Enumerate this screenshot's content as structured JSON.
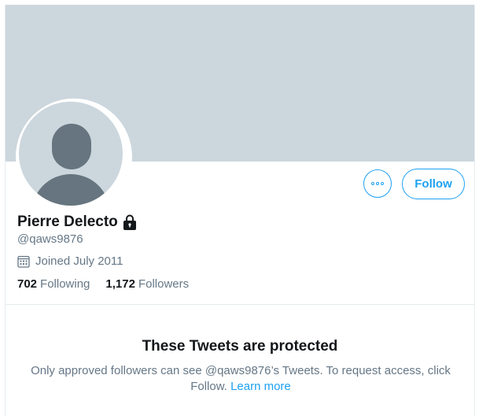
{
  "profile": {
    "name": "Pierre Delecto",
    "handle": "@qaws9876",
    "joined": "Joined July 2011",
    "following_count": "702",
    "following_label": "Following",
    "followers_count": "1,172",
    "followers_label": "Followers"
  },
  "actions": {
    "follow_label": "Follow",
    "more_icon": "more-icon"
  },
  "protected": {
    "title": "These Tweets are protected",
    "description": "Only approved followers can see @qaws9876’s Tweets. To request access, click Follow.",
    "learn_more": "Learn more"
  },
  "colors": {
    "accent": "#1da1f2",
    "banner": "#ccd6dd",
    "avatar_figure": "#66757f",
    "text_primary": "#14171a",
    "text_secondary": "#657786"
  }
}
